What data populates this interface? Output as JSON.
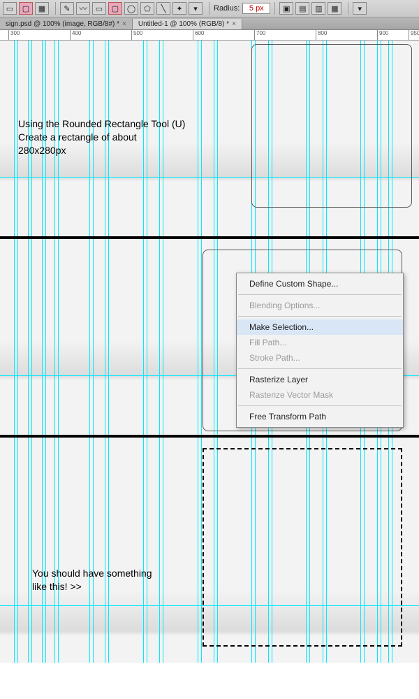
{
  "options": {
    "radius_label": "Radius:",
    "radius_value": "5 px"
  },
  "tabs": {
    "tab0_label": "sign.psd @ 100% (image, RGB/8#) *",
    "tab1_label": "Untitled-1 @ 100% (RGB/8) *"
  },
  "ruler": {
    "t300": "300",
    "t400": "400",
    "t500": "500",
    "t600": "600",
    "t700": "700",
    "t800": "800",
    "t900": "900",
    "t950": "950"
  },
  "panel1": {
    "text_l1": "Using the Rounded Rectangle Tool (U)",
    "text_l2": "Create a rectangle of about",
    "text_l3": "280x280px"
  },
  "panel3": {
    "text_l1": "You should have something",
    "text_l2": "like this! >>"
  },
  "ctx": {
    "define": "Define Custom Shape...",
    "blend": "Blending Options...",
    "makesel": "Make Selection...",
    "fill": "Fill Path...",
    "stroke": "Stroke Path...",
    "raster": "Rasterize Layer",
    "rastervm": "Rasterize Vector Mask",
    "freet": "Free Transform Path"
  }
}
